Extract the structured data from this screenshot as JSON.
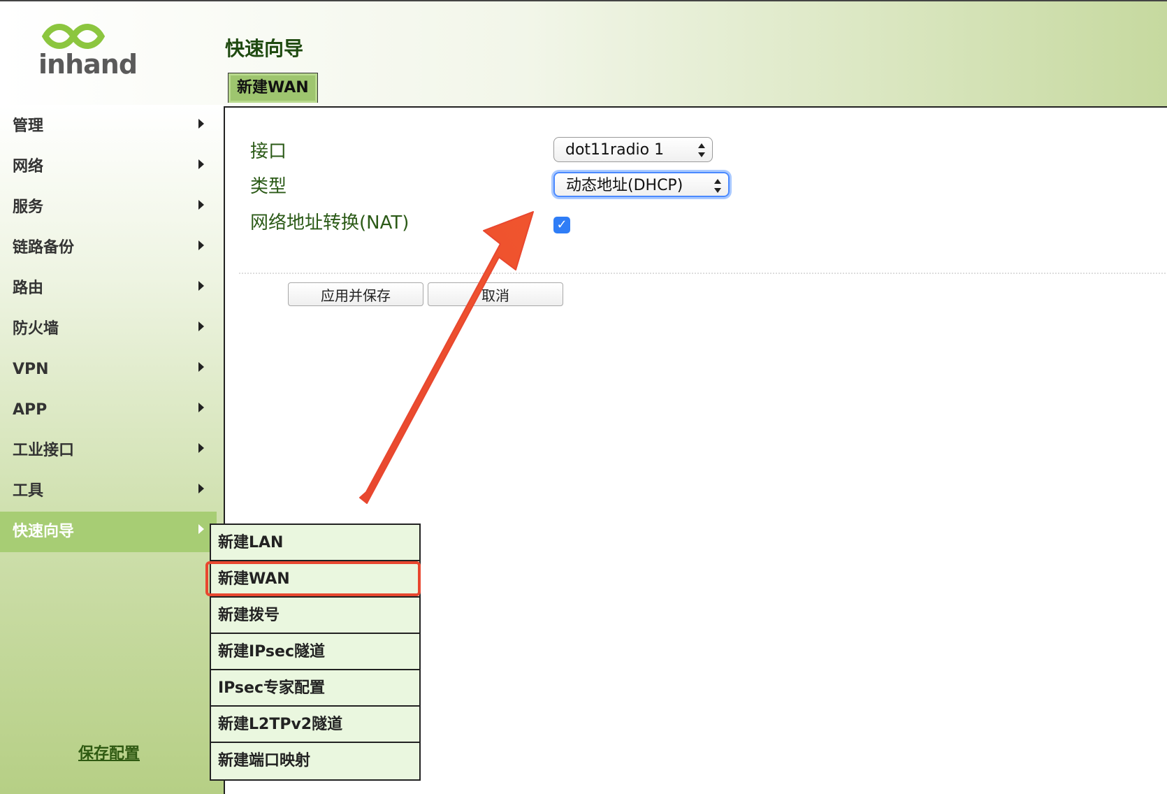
{
  "brand": {
    "logo_text": "inhand"
  },
  "sidebar": {
    "items": [
      {
        "label": "管理"
      },
      {
        "label": "网络"
      },
      {
        "label": "服务"
      },
      {
        "label": "链路备份"
      },
      {
        "label": "路由"
      },
      {
        "label": "防火墙"
      },
      {
        "label": "VPN"
      },
      {
        "label": "APP"
      },
      {
        "label": "工业接口"
      },
      {
        "label": "工具"
      },
      {
        "label": "快速向导"
      }
    ],
    "active_index": 10,
    "save_config_link": "保存配置"
  },
  "header": {
    "title": "快速向导",
    "tab_label": "新建WAN"
  },
  "form": {
    "interface_label": "接口",
    "interface_value": "dot11radio 1",
    "type_label": "类型",
    "type_value": "动态地址(DHCP)",
    "nat_label": "网络地址转换(NAT)",
    "nat_checked": true,
    "apply_button": "应用并保存",
    "cancel_button": "取消"
  },
  "submenu": {
    "items": [
      {
        "label": "新建LAN"
      },
      {
        "label": "新建WAN"
      },
      {
        "label": "新建拨号"
      },
      {
        "label": "新建IPsec隧道"
      },
      {
        "label": "IPsec专家配置"
      },
      {
        "label": "新建L2TPv2隧道"
      },
      {
        "label": "新建端口映射"
      }
    ],
    "highlighted_index": 1
  },
  "colors": {
    "accent_green": "#a7cd74",
    "label_green": "#2b5a17",
    "annotation_red": "#e8472f",
    "checkbox_blue": "#2f7df6"
  }
}
